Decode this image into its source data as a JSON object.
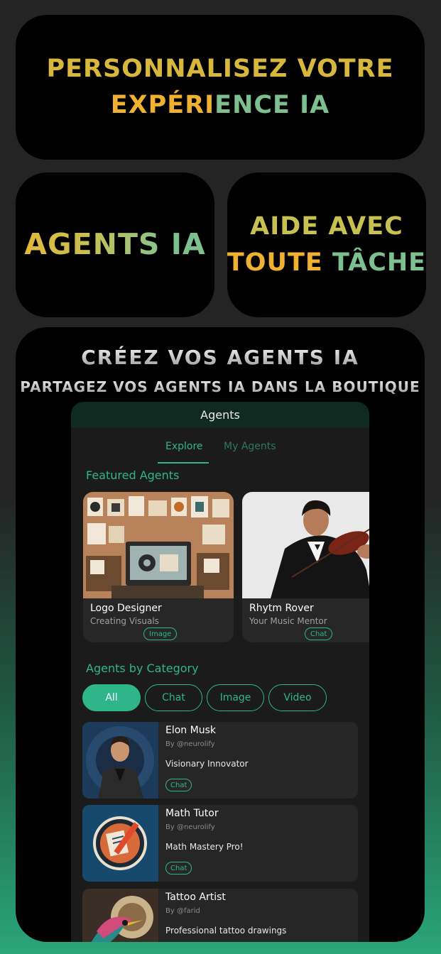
{
  "hero": {
    "line1": "PERSONNALISEZ VOTRE",
    "line2_a": "EXPÉRI",
    "line2_b": "ENCE IA"
  },
  "left_card": {
    "a": "AGENTS",
    "b": "IA"
  },
  "right_card": {
    "line1": "AIDE AVEC",
    "line2_a": "TOUTE",
    "line2_b": "TÂCHE"
  },
  "promo": {
    "title": "CRÉEZ VOS AGENTS IA",
    "subtitle": "PARTAGEZ VOS AGENTS IA DANS LA BOUTIQUE"
  },
  "phone": {
    "header": "Agents",
    "tabs": [
      "Explore",
      "My Agents"
    ],
    "featured_title": "Featured Agents",
    "featured": [
      {
        "name": "Logo Designer",
        "subtitle": "Creating Visuals",
        "tag": "Image"
      },
      {
        "name": "Rhytm Rover",
        "subtitle": "Your Music Mentor",
        "tag": "Chat"
      }
    ],
    "category_title": "Agents by Category",
    "categories": [
      "All",
      "Chat",
      "Image",
      "Video"
    ],
    "agents": [
      {
        "name": "Elon Musk",
        "by": "By @neurolify",
        "desc": "Visionary Innovator",
        "tag": "Chat"
      },
      {
        "name": "Math Tutor",
        "by": "By @neurolify",
        "desc": "Math Mastery Pro!",
        "tag": "Chat"
      },
      {
        "name": "Tattoo Artist",
        "by": "By @farid",
        "desc": "Professional tattoo drawings",
        "tag": ""
      }
    ]
  }
}
